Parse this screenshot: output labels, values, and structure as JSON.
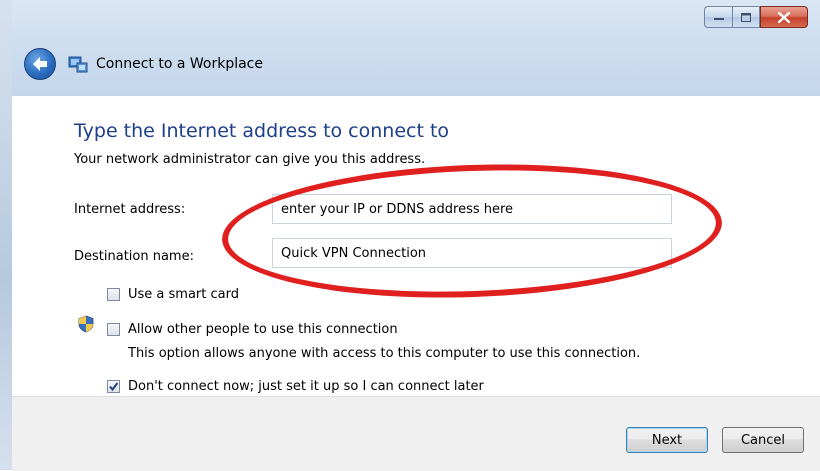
{
  "window": {
    "title": "Connect to a Workplace",
    "controls": {
      "minimize": "minimize-icon",
      "maximize": "maximize-icon",
      "close": "close-icon"
    }
  },
  "nav": {
    "back_icon": "back-arrow-icon",
    "wizard_icon": "network-connection-icon"
  },
  "page": {
    "heading": "Type the Internet address to connect to",
    "subtext": "Your network administrator can give you this address."
  },
  "form": {
    "internet_address_label": "Internet address:",
    "internet_address_value": "enter your IP or DDNS address here",
    "destination_name_label": "Destination name:",
    "destination_name_value": "Quick VPN Connection"
  },
  "options": {
    "smart_card_label": "Use a smart card",
    "smart_card_checked": false,
    "allow_others_label": "Allow other people to use this connection",
    "allow_others_checked": false,
    "allow_others_hint": "This option allows anyone with access to this computer to use this connection.",
    "dont_connect_label": "Don't connect now; just set it up so I can connect later",
    "dont_connect_checked": true
  },
  "buttons": {
    "next": "Next",
    "cancel": "Cancel"
  },
  "colors": {
    "heading": "#1e3f8a",
    "highlight_ellipse": "#e0201f"
  }
}
